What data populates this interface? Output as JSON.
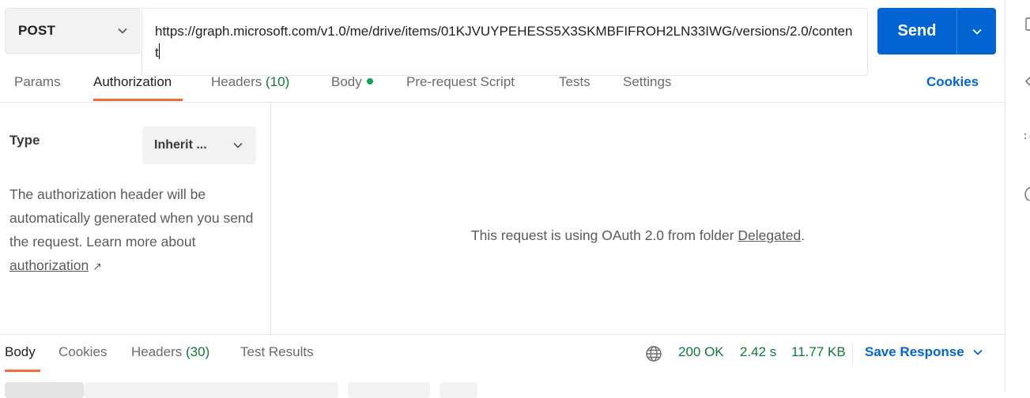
{
  "request": {
    "method": "POST",
    "url": "https://graph.microsoft.com/v1.0/me/drive/items/01KJVUYPEHESS5X3SKMBFIFROH2LN33IWG/versions/2.0/content",
    "send_label": "Send"
  },
  "tabs": {
    "params": "Params",
    "authorization": "Authorization",
    "headers": "Headers",
    "headers_count": "(10)",
    "body": "Body",
    "prerequest": "Pre-request Script",
    "tests": "Tests",
    "settings": "Settings",
    "cookies": "Cookies"
  },
  "auth": {
    "type_label": "Type",
    "type_value": "Inherit ...",
    "description": "The authorization header will be automatically generated when you send the request. Learn more about",
    "learn_link": "authorization",
    "link_arrow": "↗",
    "message_prefix": "This request is using OAuth 2.0 from folder",
    "message_link": "Delegated",
    "message_suffix": "."
  },
  "response": {
    "tabs": {
      "body": "Body",
      "cookies": "Cookies",
      "headers": "Headers",
      "headers_count": "(30)",
      "test_results": "Test Results"
    },
    "status": "200 OK",
    "time": "2.42 s",
    "size": "11.77 KB",
    "save_label": "Save Response"
  },
  "colors": {
    "accent": "#0265d2",
    "active_tab_underline": "#f26b3a",
    "status_green": "#0d7a36",
    "body_dot": "#0ca856"
  }
}
